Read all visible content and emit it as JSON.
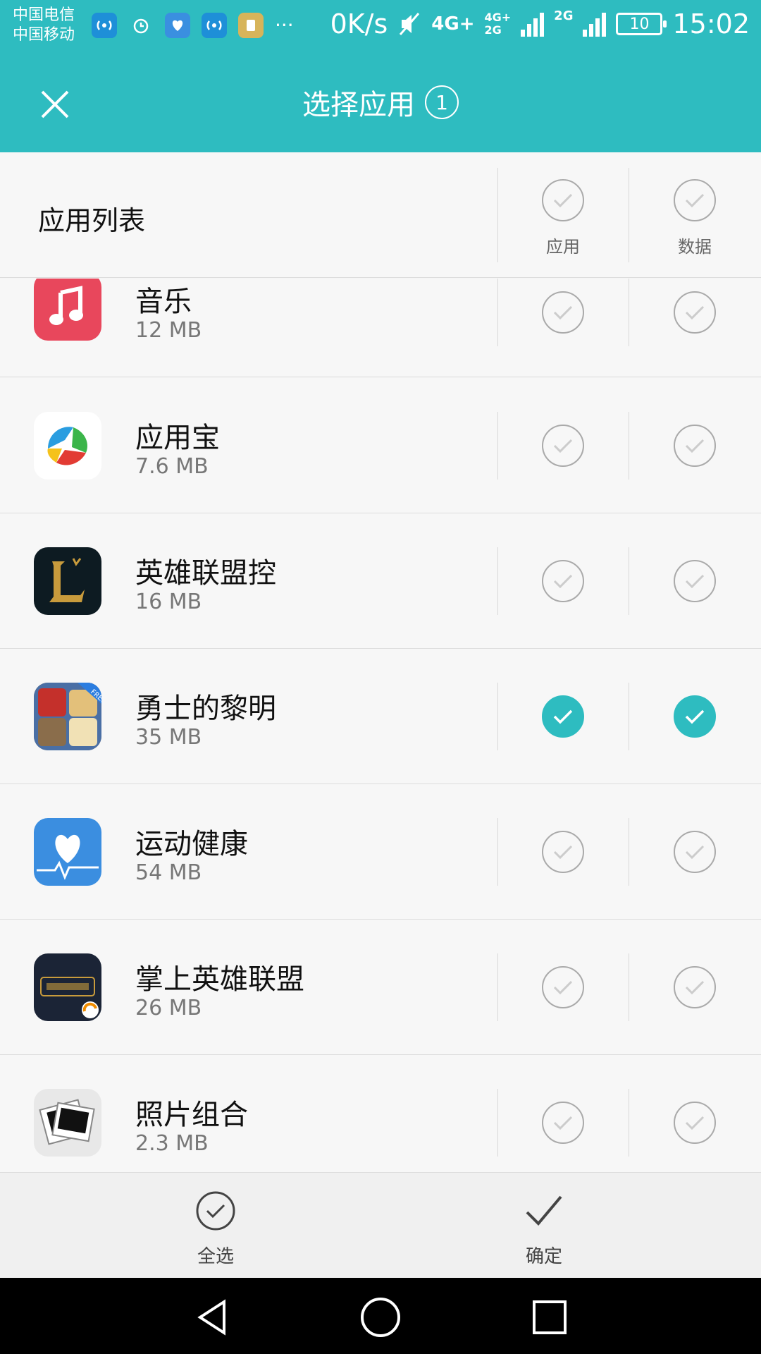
{
  "status_bar": {
    "carrier_1": "中国电信",
    "carrier_2": "中国移动",
    "net_speed": "0K/s",
    "network_1": "4G+",
    "network_2": "4G+",
    "network_3": "2G",
    "network_4": "2G",
    "battery": "10",
    "time": "15:02",
    "more": "···"
  },
  "header": {
    "title": "选择应用",
    "selected_count": "1"
  },
  "list_header": {
    "title": "应用列表",
    "col_app": "应用",
    "col_data": "数据"
  },
  "apps": [
    {
      "name": "音乐",
      "size": "12 MB",
      "app_checked": false,
      "data_checked": false,
      "icon": "music-icon"
    },
    {
      "name": "应用宝",
      "size": "7.6 MB",
      "app_checked": false,
      "data_checked": false,
      "icon": "app-store-icon"
    },
    {
      "name": "英雄联盟控",
      "size": "16 MB",
      "app_checked": false,
      "data_checked": false,
      "icon": "lol-icon"
    },
    {
      "name": "勇士的黎明",
      "size": "35 MB",
      "app_checked": true,
      "data_checked": true,
      "icon": "game-icon"
    },
    {
      "name": "运动健康",
      "size": "54 MB",
      "app_checked": false,
      "data_checked": false,
      "icon": "health-icon"
    },
    {
      "name": "掌上英雄联盟",
      "size": "26 MB",
      "app_checked": false,
      "data_checked": false,
      "icon": "lol-pocket-icon"
    },
    {
      "name": "照片组合",
      "size": "2.3 MB",
      "app_checked": false,
      "data_checked": false,
      "icon": "photo-icon"
    }
  ],
  "actions": {
    "select_all": "全选",
    "confirm": "确定"
  },
  "colors": {
    "accent": "#2ebcc0",
    "background": "#f7f7f7"
  }
}
